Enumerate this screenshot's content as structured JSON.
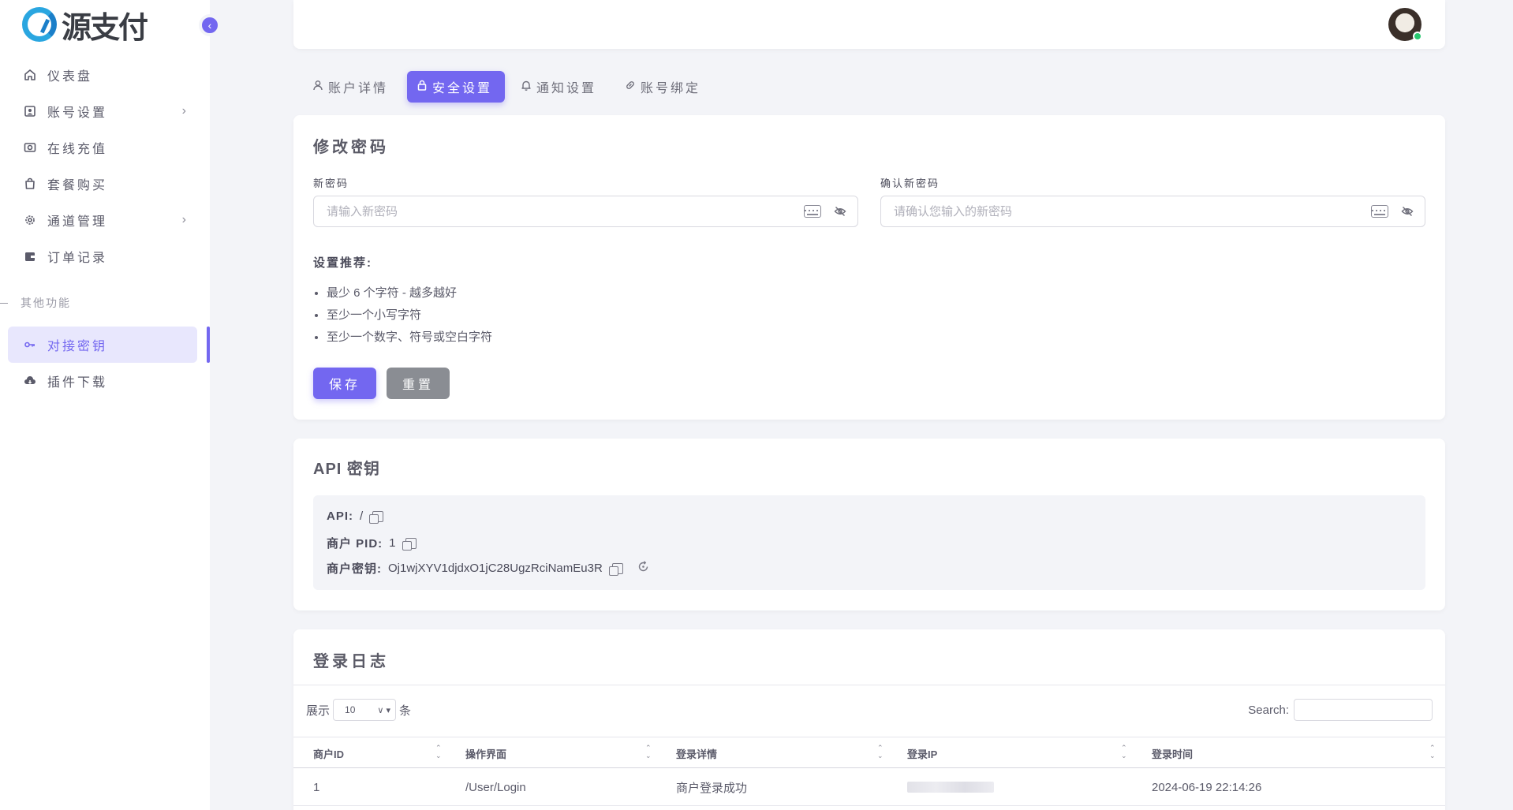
{
  "app": {
    "logo_text": "源支付"
  },
  "sidebar": {
    "items": [
      {
        "label": "仪表盘",
        "icon": "home-icon",
        "has_children": false
      },
      {
        "label": "账号设置",
        "icon": "id-card-icon",
        "has_children": true
      },
      {
        "label": "在线充值",
        "icon": "camera-icon",
        "has_children": false
      },
      {
        "label": "套餐购买",
        "icon": "shopping-bag-icon",
        "has_children": false
      },
      {
        "label": "通道管理",
        "icon": "gear-icon",
        "has_children": true
      },
      {
        "label": "订单记录",
        "icon": "wallet-icon",
        "has_children": false
      }
    ],
    "section_label": "其他功能",
    "items2": [
      {
        "label": "对接密钥",
        "icon": "key-icon",
        "active": true
      },
      {
        "label": "插件下载",
        "icon": "cloud-download-icon",
        "active": false
      }
    ]
  },
  "tabs": [
    {
      "label": "账户详情",
      "icon": "user-icon",
      "active": false
    },
    {
      "label": "安全设置",
      "icon": "lock-icon",
      "active": true
    },
    {
      "label": "通知设置",
      "icon": "bell-icon",
      "active": false
    },
    {
      "label": "账号绑定",
      "icon": "link-icon",
      "active": false
    }
  ],
  "password_card": {
    "title": "修改密码",
    "new_password_label": "新密码",
    "new_password_placeholder": "请输入新密码",
    "confirm_password_label": "确认新密码",
    "confirm_password_placeholder": "请确认您输入的新密码",
    "tips_title": "设置推荐:",
    "tips": [
      "最少 6 个字符 - 越多越好",
      "至少一个小写字符",
      "至少一个数字、符号或空白字符"
    ],
    "save_label": "保存",
    "reset_label": "重置"
  },
  "api_card": {
    "title": "API 密钥",
    "api_label": "API:",
    "api_value": "/",
    "pid_label": "商户 PID:",
    "pid_value": "1",
    "key_label": "商户密钥:",
    "key_value": "Oj1wjXYV1djdxO1jC28UgzRciNamEu3R"
  },
  "log_card": {
    "title": "登录日志",
    "show_label": "展示",
    "page_size": "10",
    "entries_label": "条",
    "search_label": "Search:",
    "columns": [
      "商户ID",
      "操作界面",
      "登录详情",
      "登录IP",
      "登录时间"
    ],
    "rows": [
      {
        "merchant_id": "1",
        "page": "/User/Login",
        "detail": "商户登录成功",
        "ip": "",
        "time": "2024-06-19 22:14:26"
      }
    ]
  },
  "colors": {
    "primary": "#7367f0",
    "secondary": "#8a8d93",
    "background": "#f3f4f8",
    "status_online": "#28c76f"
  }
}
